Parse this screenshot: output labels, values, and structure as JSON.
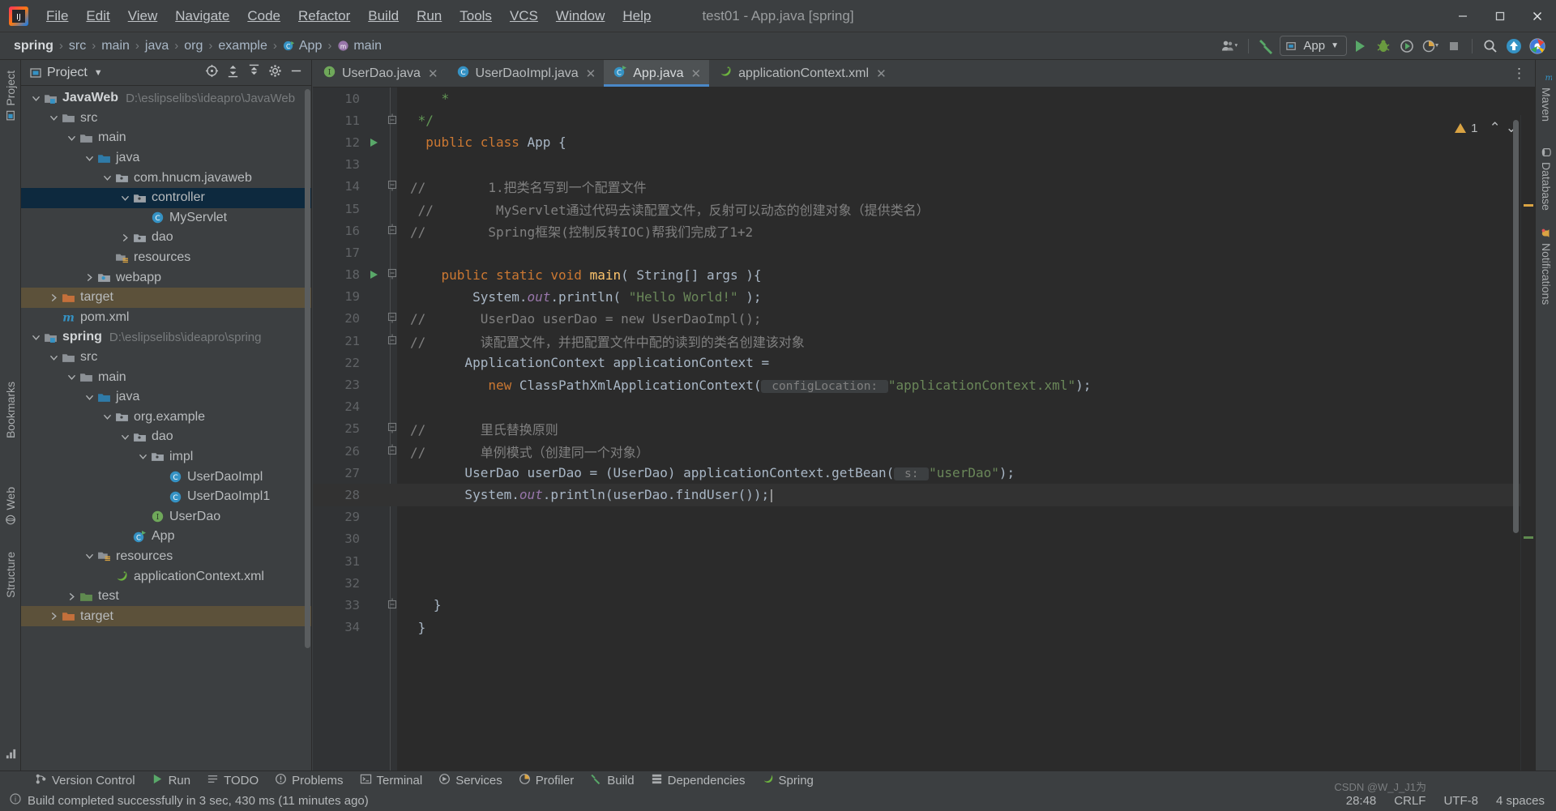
{
  "window": {
    "title": "test01 - App.java [spring]",
    "minimize_label": "Minimize",
    "maximize_label": "Maximize",
    "close_label": "Close"
  },
  "menubar": {
    "logo_name": "intellij-idea-logo",
    "items": [
      {
        "label": "File",
        "mnemonic": "F"
      },
      {
        "label": "Edit",
        "mnemonic": "E"
      },
      {
        "label": "View",
        "mnemonic": "V"
      },
      {
        "label": "Navigate",
        "mnemonic": "N"
      },
      {
        "label": "Code",
        "mnemonic": "C"
      },
      {
        "label": "Refactor",
        "mnemonic": "R"
      },
      {
        "label": "Build",
        "mnemonic": "B"
      },
      {
        "label": "Run",
        "mnemonic": "u"
      },
      {
        "label": "Tools",
        "mnemonic": "T"
      },
      {
        "label": "VCS",
        "mnemonic": "S"
      },
      {
        "label": "Window",
        "mnemonic": "W"
      },
      {
        "label": "Help",
        "mnemonic": "H"
      }
    ]
  },
  "navbar": {
    "breadcrumbs": [
      {
        "label": "spring",
        "bold": true,
        "icon": ""
      },
      {
        "label": "src",
        "bold": false,
        "icon": ""
      },
      {
        "label": "main",
        "bold": false,
        "icon": ""
      },
      {
        "label": "java",
        "bold": false,
        "icon": ""
      },
      {
        "label": "org",
        "bold": false,
        "icon": ""
      },
      {
        "label": "example",
        "bold": false,
        "icon": ""
      },
      {
        "label": "App",
        "bold": false,
        "icon": "class-icon"
      },
      {
        "label": "main",
        "bold": false,
        "icon": "method-icon"
      }
    ],
    "separator": "›",
    "run_config": "App",
    "icons": [
      "user-accounts-icon",
      "hammer-build-icon",
      "run-icon",
      "debug-icon",
      "run-coverage-icon",
      "profiler-icon",
      "stop-icon",
      "search-everywhere-icon",
      "update-icon",
      "browser-icon"
    ]
  },
  "left_stripe": {
    "tabs": [
      "Project",
      "Bookmarks",
      "Web",
      "Structure"
    ]
  },
  "right_stripe": {
    "tabs": [
      "Maven",
      "Database",
      "Notifications"
    ]
  },
  "project_panel": {
    "title": "Project",
    "dropdown": "▼",
    "toolbar_icons": [
      "select-opened-file-icon",
      "expand-all-icon",
      "collapse-all-icon",
      "settings-gear-icon",
      "hide-panel-icon"
    ],
    "tree": [
      {
        "depth": 0,
        "arrow": "down",
        "icon": "module-folder-icon",
        "label": "JavaWeb",
        "bold": true,
        "path": "D:\\eslipselibs\\ideapro\\JavaWeb",
        "state": "normal"
      },
      {
        "depth": 1,
        "arrow": "down",
        "icon": "folder-icon",
        "label": "src",
        "bold": false,
        "path": "",
        "state": "normal"
      },
      {
        "depth": 2,
        "arrow": "down",
        "icon": "folder-icon",
        "label": "main",
        "bold": false,
        "path": "",
        "state": "normal"
      },
      {
        "depth": 3,
        "arrow": "down",
        "icon": "source-folder-icon",
        "label": "java",
        "bold": false,
        "path": "",
        "state": "normal"
      },
      {
        "depth": 4,
        "arrow": "down",
        "icon": "package-icon",
        "label": "com.hnucm.javaweb",
        "bold": false,
        "path": "",
        "state": "normal"
      },
      {
        "depth": 5,
        "arrow": "down",
        "icon": "package-icon",
        "label": "controller",
        "bold": false,
        "path": "",
        "state": "selected"
      },
      {
        "depth": 6,
        "arrow": "none",
        "icon": "class-icon",
        "label": "MyServlet",
        "bold": false,
        "path": "",
        "state": "normal"
      },
      {
        "depth": 5,
        "arrow": "right",
        "icon": "package-icon",
        "label": "dao",
        "bold": false,
        "path": "",
        "state": "normal"
      },
      {
        "depth": 4,
        "arrow": "none",
        "icon": "resources-folder-icon",
        "label": "resources",
        "bold": false,
        "path": "",
        "state": "normal"
      },
      {
        "depth": 3,
        "arrow": "right",
        "icon": "webapp-folder-icon",
        "label": "webapp",
        "bold": false,
        "path": "",
        "state": "normal"
      },
      {
        "depth": 1,
        "arrow": "right",
        "icon": "target-folder-icon",
        "label": "target",
        "bold": false,
        "path": "",
        "state": "target"
      },
      {
        "depth": 1,
        "arrow": "none",
        "icon": "maven-icon",
        "label": "pom.xml",
        "bold": false,
        "path": "",
        "state": "normal"
      },
      {
        "depth": 0,
        "arrow": "down",
        "icon": "module-folder-icon",
        "label": "spring",
        "bold": true,
        "path": "D:\\eslipselibs\\ideapro\\spring",
        "state": "normal"
      },
      {
        "depth": 1,
        "arrow": "down",
        "icon": "folder-icon",
        "label": "src",
        "bold": false,
        "path": "",
        "state": "normal"
      },
      {
        "depth": 2,
        "arrow": "down",
        "icon": "folder-icon",
        "label": "main",
        "bold": false,
        "path": "",
        "state": "normal"
      },
      {
        "depth": 3,
        "arrow": "down",
        "icon": "source-folder-icon",
        "label": "java",
        "bold": false,
        "path": "",
        "state": "normal"
      },
      {
        "depth": 4,
        "arrow": "down",
        "icon": "package-icon",
        "label": "org.example",
        "bold": false,
        "path": "",
        "state": "normal"
      },
      {
        "depth": 5,
        "arrow": "down",
        "icon": "package-icon",
        "label": "dao",
        "bold": false,
        "path": "",
        "state": "normal"
      },
      {
        "depth": 6,
        "arrow": "down",
        "icon": "package-icon",
        "label": "impl",
        "bold": false,
        "path": "",
        "state": "normal"
      },
      {
        "depth": 7,
        "arrow": "none",
        "icon": "class-icon",
        "label": "UserDaoImpl",
        "bold": false,
        "path": "",
        "state": "normal"
      },
      {
        "depth": 7,
        "arrow": "none",
        "icon": "class-icon",
        "label": "UserDaoImpl1",
        "bold": false,
        "path": "",
        "state": "normal"
      },
      {
        "depth": 6,
        "arrow": "none",
        "icon": "interface-icon",
        "label": "UserDao",
        "bold": false,
        "path": "",
        "state": "normal"
      },
      {
        "depth": 5,
        "arrow": "none",
        "icon": "class-run-icon",
        "label": "App",
        "bold": false,
        "path": "",
        "state": "normal"
      },
      {
        "depth": 3,
        "arrow": "down",
        "icon": "resources-folder-icon",
        "label": "resources",
        "bold": false,
        "path": "",
        "state": "normal"
      },
      {
        "depth": 4,
        "arrow": "none",
        "icon": "spring-xml-icon",
        "label": "applicationContext.xml",
        "bold": false,
        "path": "",
        "state": "normal"
      },
      {
        "depth": 2,
        "arrow": "right",
        "icon": "test-folder-icon",
        "label": "test",
        "bold": false,
        "path": "",
        "state": "normal"
      },
      {
        "depth": 1,
        "arrow": "right",
        "icon": "target-folder-icon",
        "label": "target",
        "bold": false,
        "path": "",
        "state": "target"
      }
    ]
  },
  "editor": {
    "tabs": [
      {
        "label": "UserDao.java",
        "icon": "interface-icon",
        "active": false,
        "closable": true
      },
      {
        "label": "UserDaoImpl.java",
        "icon": "class-icon",
        "active": false,
        "closable": true
      },
      {
        "label": "App.java",
        "icon": "class-run-icon",
        "active": true,
        "closable": true
      },
      {
        "label": "applicationContext.xml",
        "icon": "spring-xml-icon",
        "active": false,
        "closable": true
      }
    ],
    "more_icon": "more-options-icon",
    "inspection_count": "1",
    "inspection_up": "⌃",
    "inspection_down": "⌄",
    "lines": [
      {
        "n": "10",
        "gutter": "",
        "current": false,
        "tokens": [
          {
            "t": "    ",
            "c": "plain"
          },
          {
            "t": "*",
            "c": "cmt-doc"
          }
        ]
      },
      {
        "n": "11",
        "gutter": "fold-end",
        "current": false,
        "tokens": [
          {
            "t": " ",
            "c": "plain"
          },
          {
            "t": "*/",
            "c": "cmt-doc"
          }
        ]
      },
      {
        "n": "12",
        "gutter": "run",
        "current": false,
        "tokens": [
          {
            "t": "  ",
            "c": "plain"
          },
          {
            "t": "public class ",
            "c": "kw"
          },
          {
            "t": "App",
            "c": "ident"
          },
          {
            "t": " {",
            "c": "plain"
          }
        ]
      },
      {
        "n": "13",
        "gutter": "",
        "current": false,
        "tokens": []
      },
      {
        "n": "14",
        "gutter": "fold-start",
        "current": false,
        "tokens": [
          {
            "t": "//        1.把类名写到一个配置文件",
            "c": "cmt"
          }
        ]
      },
      {
        "n": "15",
        "gutter": "",
        "current": false,
        "tokens": [
          {
            "t": " //        MyServlet通过代码去读配置文件，反射可以动态的创建对象（提供类名）",
            "c": "cmt"
          }
        ]
      },
      {
        "n": "16",
        "gutter": "fold-end",
        "current": false,
        "tokens": [
          {
            "t": "//        Spring框架(控制反转IOC)帮我们完成了1+2",
            "c": "cmt"
          }
        ]
      },
      {
        "n": "17",
        "gutter": "",
        "current": false,
        "tokens": []
      },
      {
        "n": "18",
        "gutter": "run-fold",
        "current": false,
        "tokens": [
          {
            "t": "    ",
            "c": "plain"
          },
          {
            "t": "public static void ",
            "c": "kw"
          },
          {
            "t": "main",
            "c": "mth"
          },
          {
            "t": "( String[] args ){",
            "c": "plain"
          }
        ]
      },
      {
        "n": "19",
        "gutter": "",
        "current": false,
        "tokens": [
          {
            "t": "        System.",
            "c": "plain"
          },
          {
            "t": "out",
            "c": "fld"
          },
          {
            "t": ".println( ",
            "c": "plain"
          },
          {
            "t": "\"Hello World!\"",
            "c": "str"
          },
          {
            "t": " );",
            "c": "plain"
          }
        ]
      },
      {
        "n": "20",
        "gutter": "fold-start",
        "current": false,
        "tokens": [
          {
            "t": "//       UserDao userDao = new UserDaoImpl();",
            "c": "cmt"
          }
        ]
      },
      {
        "n": "21",
        "gutter": "fold-end",
        "current": false,
        "tokens": [
          {
            "t": "//       读配置文件，并把配置文件中配的读到的类名创建该对象",
            "c": "cmt"
          }
        ]
      },
      {
        "n": "22",
        "gutter": "",
        "current": false,
        "tokens": [
          {
            "t": "       ApplicationContext applicationContext =",
            "c": "plain"
          }
        ]
      },
      {
        "n": "23",
        "gutter": "",
        "current": false,
        "tokens": [
          {
            "t": "          ",
            "c": "plain"
          },
          {
            "t": "new ",
            "c": "kw"
          },
          {
            "t": "ClassPathXmlApplicationContext(",
            "c": "plain"
          },
          {
            "t": " configLocation: ",
            "c": "hint"
          },
          {
            "t": "\"applicationContext.xml\"",
            "c": "str"
          },
          {
            "t": ");",
            "c": "plain"
          }
        ]
      },
      {
        "n": "24",
        "gutter": "",
        "current": false,
        "tokens": []
      },
      {
        "n": "25",
        "gutter": "fold-start",
        "current": false,
        "tokens": [
          {
            "t": "//       里氏替换原则",
            "c": "cmt"
          }
        ]
      },
      {
        "n": "26",
        "gutter": "fold-end",
        "current": false,
        "tokens": [
          {
            "t": "//       单例模式（创建同一个对象）",
            "c": "cmt"
          }
        ]
      },
      {
        "n": "27",
        "gutter": "",
        "current": false,
        "tokens": [
          {
            "t": "       UserDao userDao = (UserDao) applicationContext.getBean(",
            "c": "plain"
          },
          {
            "t": " s: ",
            "c": "hint"
          },
          {
            "t": "\"userDao\"",
            "c": "str"
          },
          {
            "t": ");",
            "c": "plain"
          }
        ]
      },
      {
        "n": "28",
        "gutter": "",
        "current": true,
        "tokens": [
          {
            "t": "       System.",
            "c": "plain"
          },
          {
            "t": "out",
            "c": "fld"
          },
          {
            "t": ".println(userDao.findUser());",
            "c": "plain"
          },
          {
            "t": "|",
            "c": "caret"
          }
        ]
      },
      {
        "n": "29",
        "gutter": "",
        "current": false,
        "tokens": []
      },
      {
        "n": "30",
        "gutter": "",
        "current": false,
        "tokens": []
      },
      {
        "n": "31",
        "gutter": "",
        "current": false,
        "tokens": []
      },
      {
        "n": "32",
        "gutter": "",
        "current": false,
        "tokens": []
      },
      {
        "n": "33",
        "gutter": "fold-end",
        "current": false,
        "tokens": [
          {
            "t": "   }",
            "c": "plain"
          }
        ]
      },
      {
        "n": "34",
        "gutter": "",
        "current": false,
        "tokens": [
          {
            "t": " }",
            "c": "plain"
          }
        ]
      }
    ]
  },
  "bottom_toolbar": {
    "items": [
      {
        "label": "Version Control",
        "icon": "version-control-icon"
      },
      {
        "label": "Run",
        "icon": "run-icon"
      },
      {
        "label": "TODO",
        "icon": "todo-icon"
      },
      {
        "label": "Problems",
        "icon": "problems-icon"
      },
      {
        "label": "Terminal",
        "icon": "terminal-icon"
      },
      {
        "label": "Services",
        "icon": "services-icon"
      },
      {
        "label": "Profiler",
        "icon": "profiler-icon"
      },
      {
        "label": "Build",
        "icon": "build-hammer-icon"
      },
      {
        "label": "Dependencies",
        "icon": "dependencies-icon"
      },
      {
        "label": "Spring",
        "icon": "spring-leaf-icon"
      }
    ]
  },
  "statusbar": {
    "message": "Build completed successfully in 3 sec, 430 ms (11 minutes ago)",
    "caret_position": "28:48",
    "line_separator": "CRLF",
    "encoding": "UTF-8",
    "indent": "4 spaces",
    "watermark": "CSDN @W_J_J1为"
  }
}
